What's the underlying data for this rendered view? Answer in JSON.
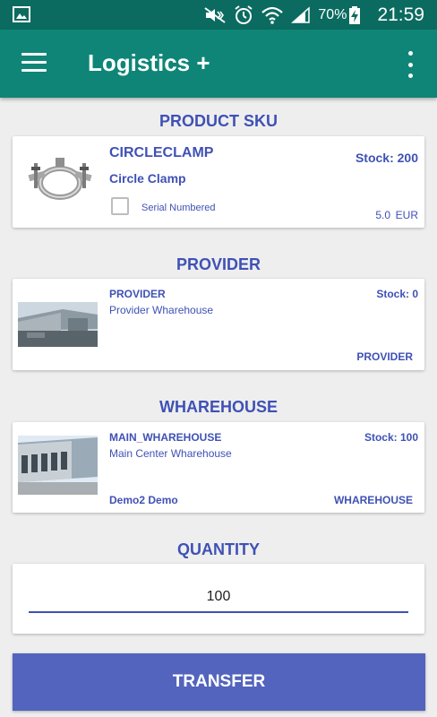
{
  "status_bar": {
    "battery": "70%",
    "time": "21:59"
  },
  "app_bar": {
    "title": "Logistics +"
  },
  "product": {
    "section_title": "PRODUCT SKU",
    "code": "CIRCLECLAMP",
    "name": "Circle Clamp",
    "stock": "Stock: 200",
    "serial_label": "Serial Numbered",
    "serial_checked": false,
    "price": "5.0",
    "currency": "EUR"
  },
  "provider": {
    "section_title": "PROVIDER",
    "code": "PROVIDER",
    "name": "Provider Wharehouse",
    "stock": "Stock: 0",
    "type": "PROVIDER"
  },
  "warehouse": {
    "section_title": "WHAREHOUSE",
    "code": "MAIN_WHAREHOUSE",
    "name": "Main Center Wharehouse",
    "stock": "Stock: 100",
    "owner": "Demo2 Demo",
    "type": "WHAREHOUSE"
  },
  "quantity": {
    "section_title": "QUANTITY",
    "value": "100"
  },
  "transfer_label": "TRANSFER",
  "colors": {
    "status_bar": "#0b6b60",
    "app_bar": "#0f8577",
    "accent": "#3f51b5",
    "button": "#5264bd",
    "background": "#eeeeee"
  }
}
